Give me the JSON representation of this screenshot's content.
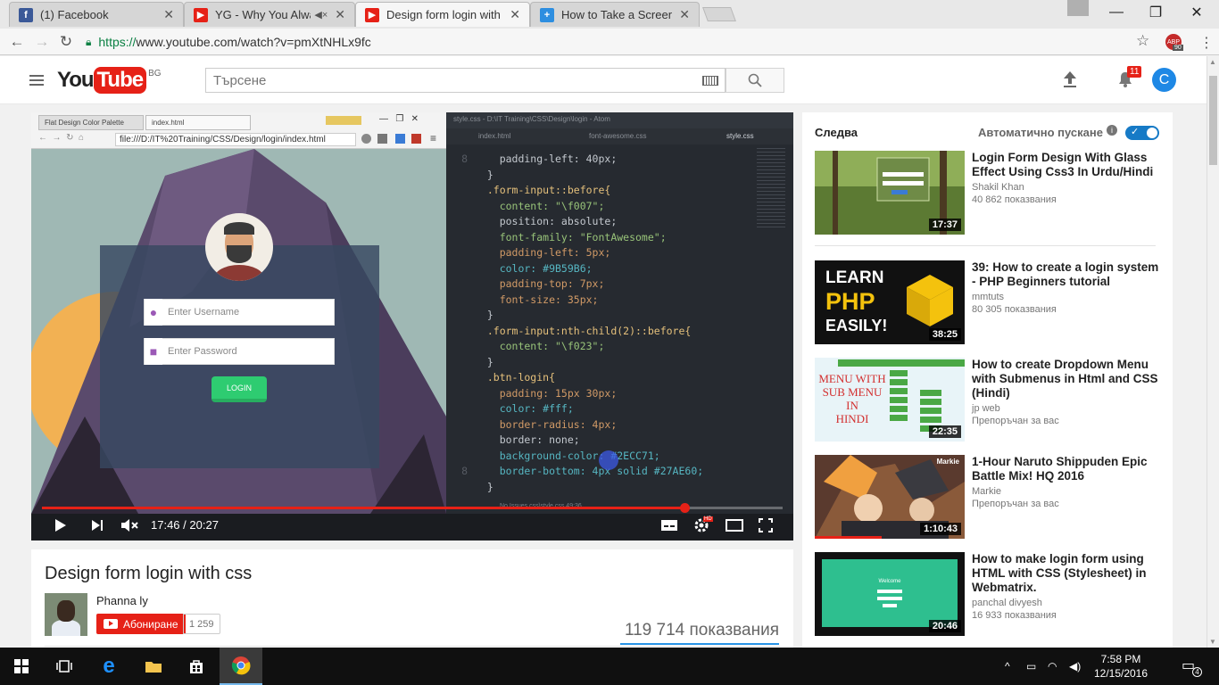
{
  "browser": {
    "tabs": [
      {
        "title": "(1) Facebook",
        "favicon": "facebook-icon",
        "color": "#3b5998",
        "muted": false,
        "active": false
      },
      {
        "title": "YG - Why You Always",
        "favicon": "youtube-icon",
        "color": "#e62117",
        "muted": true,
        "active": false
      },
      {
        "title": "Design form login with c",
        "favicon": "youtube-icon",
        "color": "#e62117",
        "muted": false,
        "active": true
      },
      {
        "title": "How to Take a Screenshc",
        "favicon": "plus-icon",
        "color": "#2d8ee0",
        "muted": false,
        "active": false
      }
    ],
    "url_scheme": "https://",
    "url_rest": "www.youtube.com/watch?v=pmXtNHLx9fc",
    "adblock_label": "ABP",
    "adblock_count": "90"
  },
  "youtube": {
    "logo_you": "You",
    "logo_tube": "Tube",
    "region": "BG",
    "search_placeholder": "Търсене",
    "notification_count": "11",
    "avatar_letter": "C"
  },
  "player": {
    "time_current": "17:46",
    "time_total": "20:27",
    "time_separator": " / ",
    "progress": 0.868,
    "hd_label": "HD",
    "inner_browser": {
      "tab1": "Flat Design Color Palette",
      "tab2": "index.html",
      "address": "file:///D:/IT%20Training/CSS/Design/login/index.html",
      "username_placeholder": "Enter Username",
      "password_placeholder": "Enter Password",
      "login_button": "LOGIN"
    },
    "editor": {
      "title": "style.css - D:\\IT Training\\CSS\\Design\\login - Atom",
      "tabs": [
        "index.html",
        "font-awesome.css",
        "style.css"
      ],
      "line_numbers": [
        "8",
        "",
        "",
        "",
        "",
        "",
        "",
        "",
        "",
        "",
        "",
        "",
        "",
        "",
        "",
        "",
        "",
        "",
        "",
        "",
        "8",
        ""
      ],
      "status": "No Issues  css\\style.css  49:36",
      "code": [
        {
          "text": "    padding-left: 40px;",
          "cls": "prop"
        },
        {
          "text": "  }",
          "cls": "brace"
        },
        {
          "text": "  .form-input::before{",
          "cls": "sel"
        },
        {
          "text": "    content: \"\\f007\";",
          "cls": "str"
        },
        {
          "text": "    position: absolute;",
          "cls": "prop"
        },
        {
          "text": "    font-family: \"FontAwesome\";",
          "cls": "str"
        },
        {
          "text": "    padding-left: 5px;",
          "cls": "num"
        },
        {
          "text": "    color: #9B59B6;",
          "cls": "col"
        },
        {
          "text": "    padding-top: 7px;",
          "cls": "num"
        },
        {
          "text": "    font-size: 35px;",
          "cls": "num"
        },
        {
          "text": "  }",
          "cls": "brace"
        },
        {
          "text": "  .form-input:nth-child(2)::before{",
          "cls": "sel"
        },
        {
          "text": "    content: \"\\f023\";",
          "cls": "str"
        },
        {
          "text": "  }",
          "cls": "brace"
        },
        {
          "text": "  .btn-login{",
          "cls": "sel"
        },
        {
          "text": "    padding: 15px 30px;",
          "cls": "num"
        },
        {
          "text": "    color: #fff;",
          "cls": "col"
        },
        {
          "text": "    border-radius: 4px;",
          "cls": "num"
        },
        {
          "text": "    border: none;",
          "cls": "prop"
        },
        {
          "text": "    background-color: #2ECC71;",
          "cls": "col"
        },
        {
          "text": "    border-bottom: 4px solid #27AE60;",
          "cls": "col"
        },
        {
          "text": "  }",
          "cls": "brace"
        }
      ]
    }
  },
  "video": {
    "title": "Design form login with css",
    "channel": "Phanna ly",
    "subscribe_label": "Абониране",
    "subscriber_count": "1 259",
    "views": "119 714 показвания"
  },
  "sidebar": {
    "up_next": "Следва",
    "autoplay": "Автоматично пускане",
    "autoplay_on": true,
    "items": [
      {
        "title": "Login Form Design With Glass Effect Using Css3 In Urdu/Hindi",
        "channel": "Shakil Khan",
        "meta": "40 862 показвания",
        "duration": "17:37",
        "thumb": "forest"
      },
      {
        "title": "39: How to create a login system - PHP Beginners tutorial",
        "channel": "mmtuts",
        "meta": "80 305 показвания",
        "duration": "38:25",
        "thumb": "php",
        "thumb_text_1": "LEARN",
        "thumb_text_2": "PHP",
        "thumb_text_3": "EASILY!"
      },
      {
        "title": "How to create Dropdown Menu with Submenus in Html and CSS (Hindi)",
        "channel": "jp web",
        "meta": "Препоръчан за вас",
        "duration": "22:35",
        "thumb": "menu",
        "thumb_text_1": "MENU WITH",
        "thumb_text_2": "SUB MENU",
        "thumb_text_3": "IN",
        "thumb_text_4": "HINDI"
      },
      {
        "title": "1-Hour Naruto Shippuden Epic Battle Mix! HQ 2016",
        "channel": "Markie",
        "meta": "Препоръчан за вас",
        "duration": "1:10:43",
        "thumb": "anime",
        "thumb_text_1": "Markie"
      },
      {
        "title": "How to make login form using HTML with CSS (Stylesheet) in Webmatrix.",
        "channel": "panchal divyesh",
        "meta": "16 933 показвания",
        "duration": "20:46",
        "thumb": "teal",
        "thumb_text_1": "Welcome"
      }
    ]
  },
  "taskbar": {
    "time": "7:58 PM",
    "date": "12/15/2016",
    "notifications": "4"
  }
}
